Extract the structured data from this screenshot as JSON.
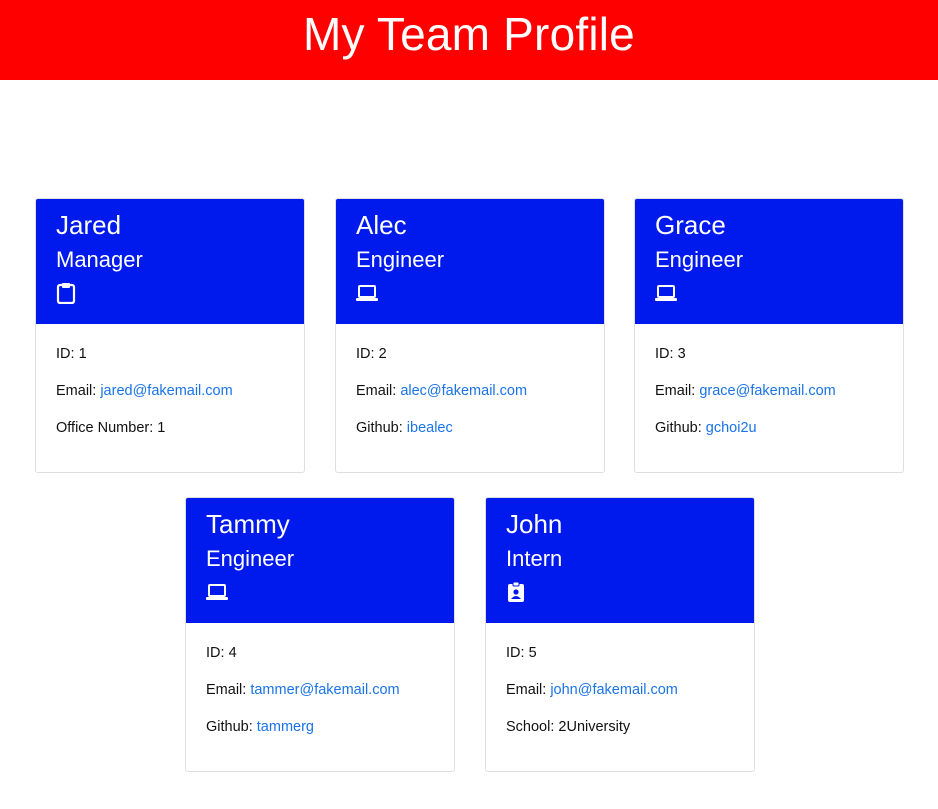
{
  "page": {
    "title": "My Team Profile"
  },
  "colors": {
    "header": "#ff0000",
    "card_header": "#0019ec",
    "link": "#1a73e8"
  },
  "employees": [
    {
      "name": "Jared",
      "role": "Manager",
      "icon": "clipboard-icon",
      "id_label": "ID:",
      "id": "1",
      "email_label": "Email:",
      "email": "jared@fakemail.com",
      "extra_label": "Office Number:",
      "extra": "1"
    },
    {
      "name": "Alec",
      "role": "Engineer",
      "icon": "laptop-icon",
      "id_label": "ID:",
      "id": "2",
      "email_label": "Email:",
      "email": "alec@fakemail.com",
      "extra_label": "Github:",
      "extra": "ibealec"
    },
    {
      "name": "Grace",
      "role": "Engineer",
      "icon": "laptop-icon",
      "id_label": "ID:",
      "id": "3",
      "email_label": "Email:",
      "email": "grace@fakemail.com",
      "extra_label": "Github:",
      "extra": "gchoi2u"
    },
    {
      "name": "Tammy",
      "role": "Engineer",
      "icon": "laptop-icon",
      "id_label": "ID:",
      "id": "4",
      "email_label": "Email:",
      "email": "tammer@fakemail.com",
      "extra_label": "Github:",
      "extra": "tammerg"
    },
    {
      "name": "John",
      "role": "Intern",
      "icon": "id-badge-icon",
      "id_label": "ID:",
      "id": "5",
      "email_label": "Email:",
      "email": "john@fakemail.com",
      "extra_label": "School:",
      "extra": "2University"
    }
  ]
}
